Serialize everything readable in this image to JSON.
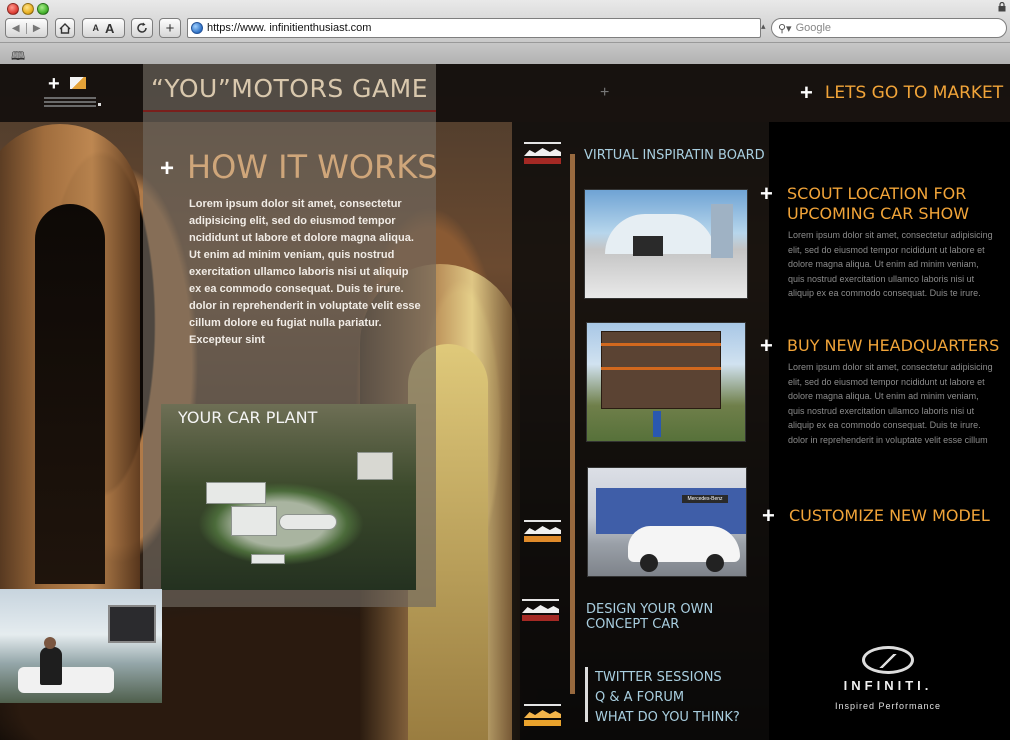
{
  "browser": {
    "url": "https://www. infinitienthusiast.com",
    "search_placeholder": "Google",
    "aa_small": "A",
    "aa_large": "A"
  },
  "header": {
    "game_title": "“YOU”MOTORS GAME",
    "market_link": "LETS GO TO MARKET"
  },
  "how_it_works": {
    "title": "HOW IT WORKS",
    "body": "Lorem ipsum dolor sit amet, consectetur adipisicing elit, sed do eiusmod tempor ncididunt ut labore et dolore magna aliqua. Ut enim ad minim veniam, quis nostrud exercitation ullamco laboris nisi ut aliquip ex ea commodo consequat. Duis te irure. dolor in reprehenderit in voluptate velit esse cillum dolore eu fugiat nulla pariatur. Excepteur sint"
  },
  "car_plant": {
    "title": "YOUR CAR PLANT"
  },
  "timeline": {
    "board_title": "VIRTUAL INSPIRATIN BOARD",
    "design_title": "DESIGN YOUR OWN CONCEPT CAR",
    "social_links": [
      "TWITTER SESSIONS",
      "Q & A FORUM",
      "WHAT DO YOU THINK?"
    ]
  },
  "features": [
    {
      "title": "SCOUT LOCATION FOR UPCOMING CAR SHOW",
      "desc": "Lorem ipsum dolor sit amet, consectetur adipisicing elit, sed do eiusmod tempor ncididunt ut labore et dolore magna aliqua. Ut enim ad minim veniam, quis nostrud exercitation ullamco laboris nisi ut aliquip ex ea commodo consequat. Duis te irure."
    },
    {
      "title": "BUY NEW HEADQUARTERS",
      "desc": "Lorem ipsum dolor sit amet, consectetur adipisicing elit, sed do eiusmod tempor ncididunt ut labore et dolore magna aliqua. Ut enim ad minim veniam, quis nostrud exercitation ullamco laboris nisi ut aliquip ex ea commodo consequat. Duis te irure. dolor in reprehenderit in voluptate velit esse cillum"
    },
    {
      "title": "CUSTOMIZE NEW MODEL"
    }
  ],
  "brand": {
    "name": "INFINITI.",
    "tagline": "Inspired Performance",
    "showroom_sign": "Mercedes-Benz"
  },
  "colors": {
    "accent_orange": "#f1a439",
    "link_blue": "#a9cfe0",
    "title_tan": "#cfa67a"
  }
}
